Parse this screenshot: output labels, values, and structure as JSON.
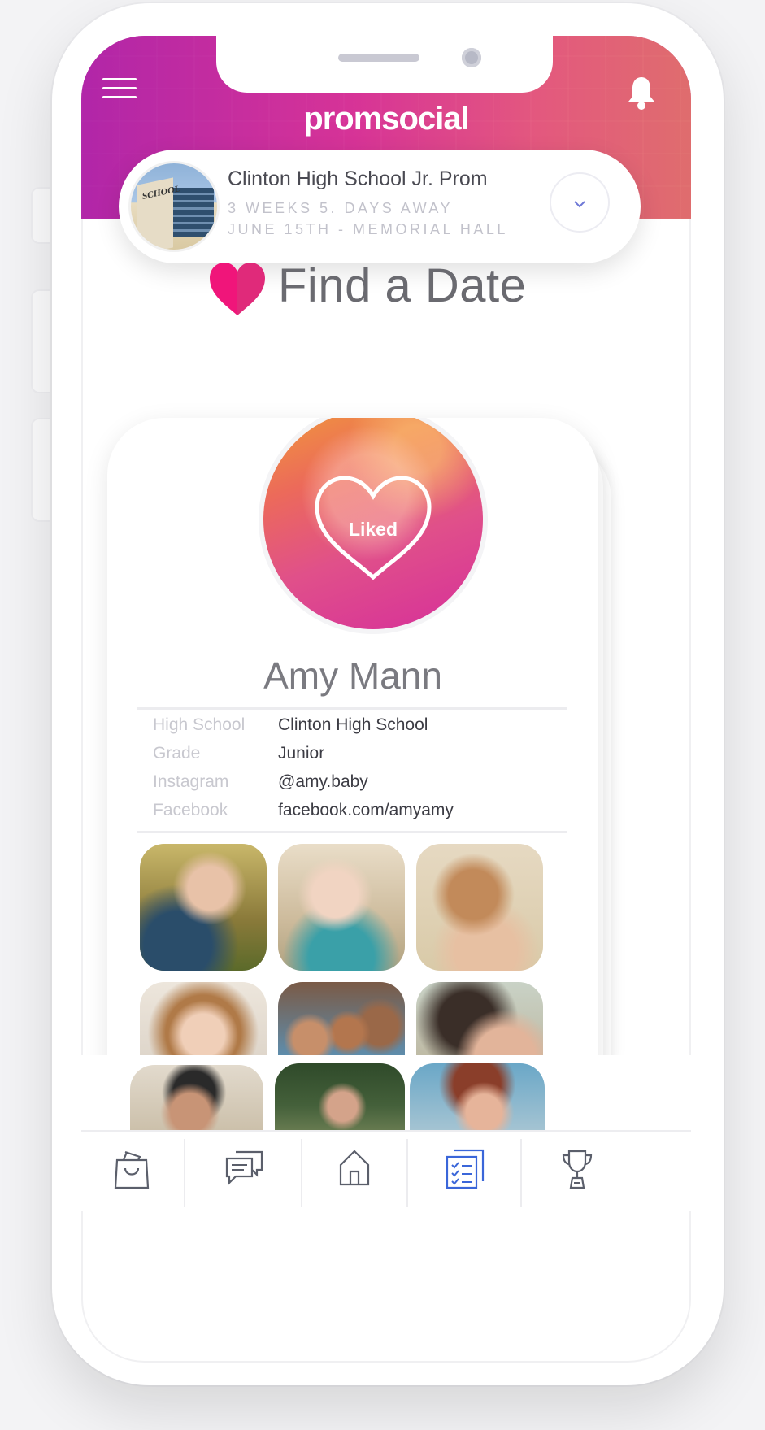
{
  "header": {
    "brand": "promsocial"
  },
  "event": {
    "title": "Clinton High School Jr. Prom",
    "countdown": "3 WEEKS  5. DAYS AWAY",
    "date_venue": "JUNE 15TH -  MEMORIAL  HALL",
    "thumb_sign": "SCHOOL"
  },
  "page": {
    "title": "Find a Date"
  },
  "profile": {
    "status": "Liked",
    "name": "Amy Mann",
    "fields": [
      {
        "label": "High School",
        "value": "Clinton High School"
      },
      {
        "label": "Grade",
        "value": "Junior"
      },
      {
        "label": "Instagram",
        "value": "@amy.baby"
      },
      {
        "label": "Facebook",
        "value": "facebook.com/amyamy"
      }
    ]
  },
  "tabs": [
    {
      "name": "shop",
      "icon": "shopping-bag-icon"
    },
    {
      "name": "chat",
      "icon": "chat-bubbles-icon"
    },
    {
      "name": "home",
      "icon": "home-icon"
    },
    {
      "name": "checklist",
      "icon": "checklist-icon",
      "active": true
    },
    {
      "name": "awards",
      "icon": "trophy-icon"
    }
  ],
  "colors": {
    "accent": "#e0338a",
    "active_tab": "#3a66d9",
    "header_gradient_start": "#b026b0",
    "header_gradient_end": "#e6786a"
  }
}
